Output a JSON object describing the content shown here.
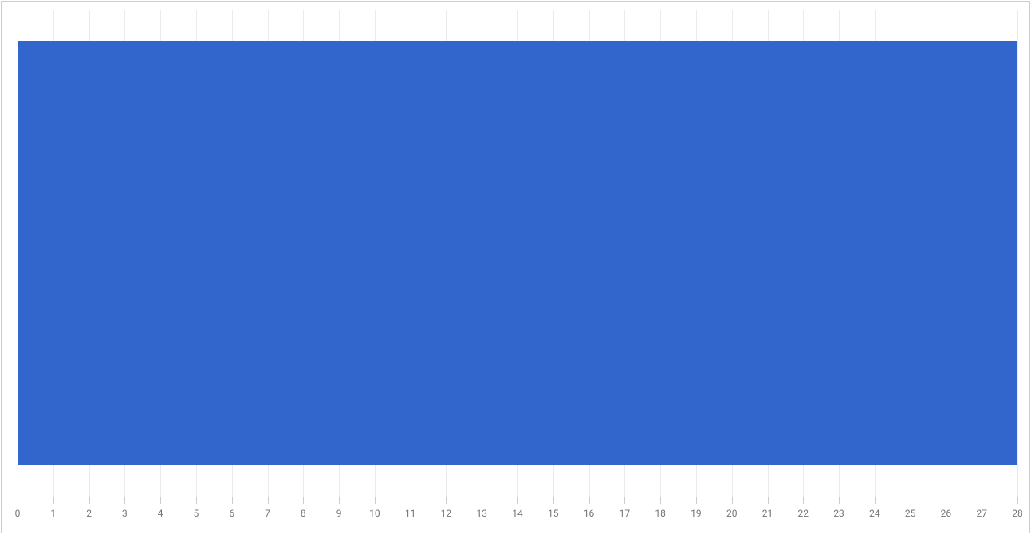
{
  "chart_data": {
    "type": "bar",
    "orientation": "horizontal",
    "categories": [
      ""
    ],
    "values": [
      28
    ],
    "xlim": [
      0,
      28
    ],
    "xticks": [
      0,
      1,
      2,
      3,
      4,
      5,
      6,
      7,
      8,
      9,
      10,
      11,
      12,
      13,
      14,
      15,
      16,
      17,
      18,
      19,
      20,
      21,
      22,
      23,
      24,
      25,
      26,
      27,
      28
    ],
    "bar_color": "#3366cc",
    "title": "",
    "xlabel": "",
    "ylabel": ""
  }
}
